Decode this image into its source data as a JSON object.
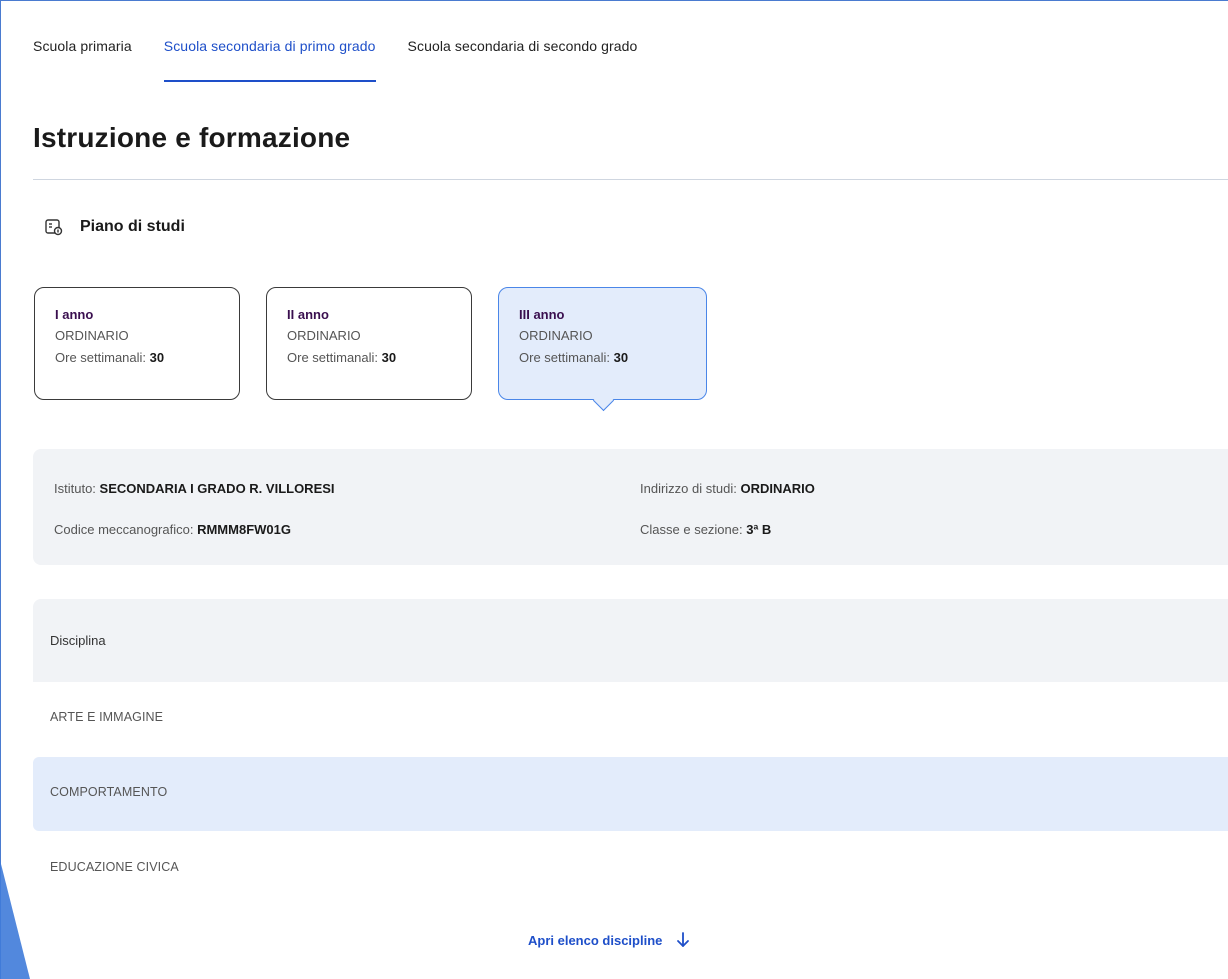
{
  "tabs": [
    {
      "label": "Scuola primaria",
      "active": false
    },
    {
      "label": "Scuola secondaria di primo grado",
      "active": true
    },
    {
      "label": "Scuola secondaria di secondo grado",
      "active": false
    }
  ],
  "page_title": "Istruzione e formazione",
  "section": {
    "icon": "study-plan-icon",
    "label": "Piano di studi"
  },
  "year_cards": [
    {
      "year": "I anno",
      "type": "ORDINARIO",
      "hours_label": "Ore settimanali:",
      "hours_value": "30",
      "active": false
    },
    {
      "year": "II anno",
      "type": "ORDINARIO",
      "hours_label": "Ore settimanali:",
      "hours_value": "30",
      "active": false
    },
    {
      "year": "III anno",
      "type": "ORDINARIO",
      "hours_label": "Ore settimanali:",
      "hours_value": "30",
      "active": true
    }
  ],
  "info": {
    "istituto_label": "Istituto:",
    "istituto_value": "SECONDARIA I GRADO R. VILLORESI",
    "codice_label": "Codice meccanografico:",
    "codice_value": "RMMM8FW01G",
    "indirizzo_label": "Indirizzo di studi:",
    "indirizzo_value": "ORDINARIO",
    "classe_label": "Classe e sezione:",
    "classe_value": "3ª B"
  },
  "table": {
    "header": "Disciplina",
    "rows": [
      "ARTE E IMMAGINE",
      "COMPORTAMENTO",
      "EDUCAZIONE CIVICA"
    ]
  },
  "open_link": {
    "label": "Apri elenco discipline",
    "icon": "arrow-down-icon"
  },
  "colors": {
    "accent": "#1e4fc9",
    "selected_bg": "#e3ecfb",
    "panel_bg": "#f1f3f6"
  }
}
